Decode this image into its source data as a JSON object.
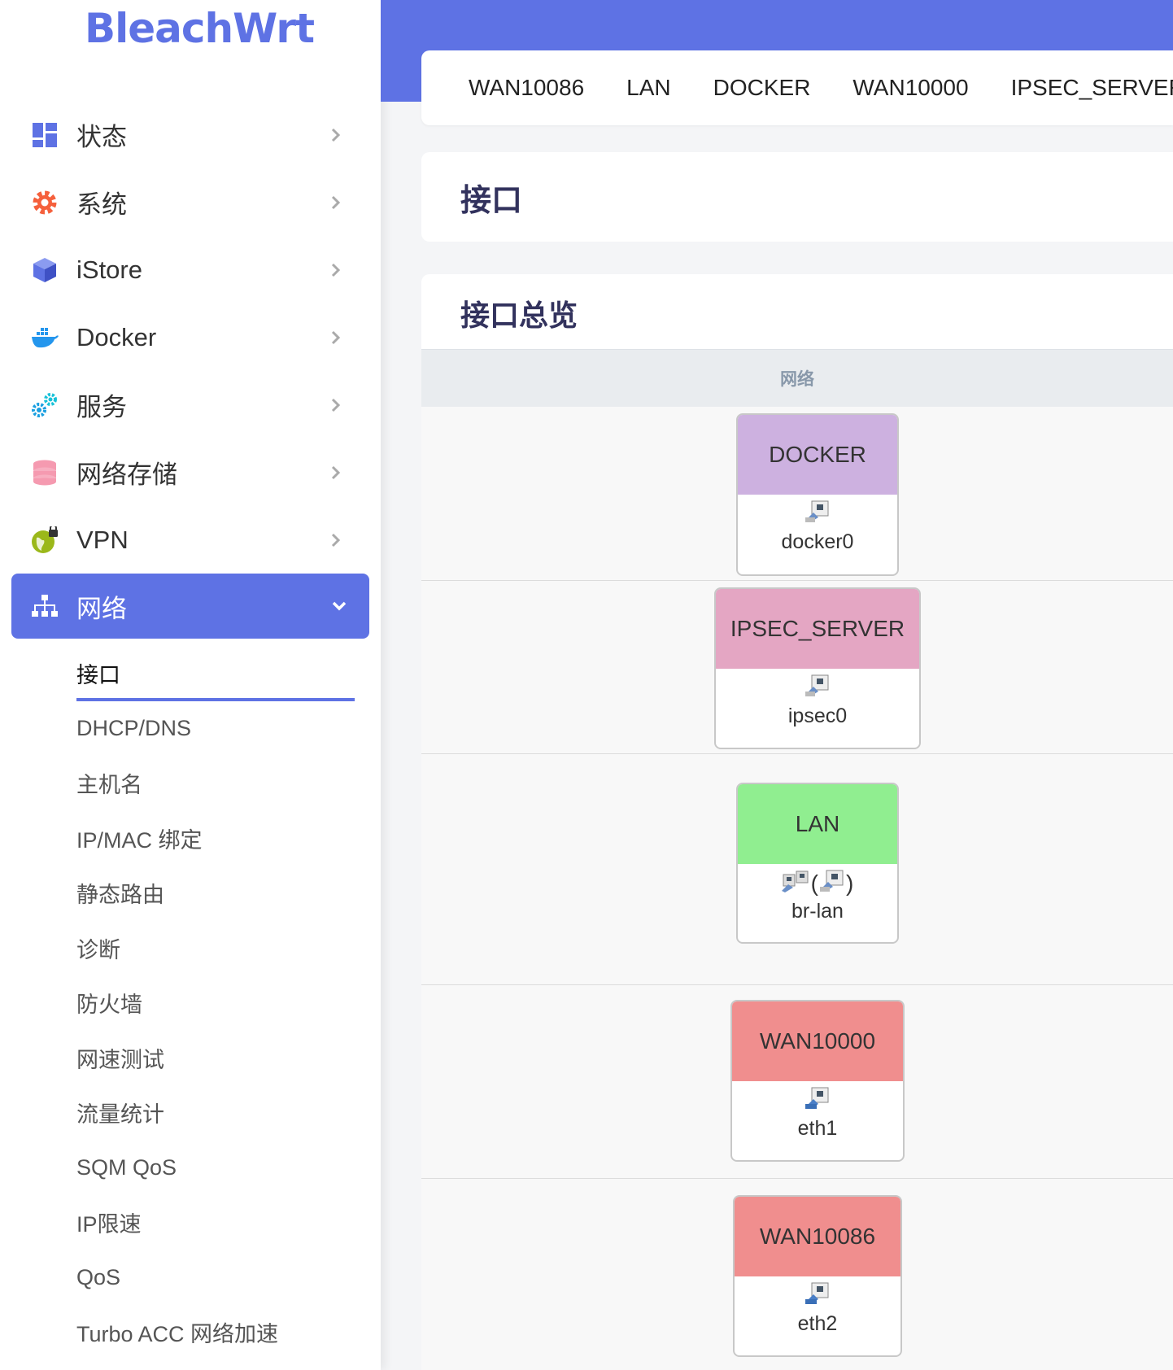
{
  "brand": "BleachWrt",
  "colors": {
    "accent": "#5e72e4",
    "docker": "#cdb1e0",
    "ipsec": "#e4a6c3",
    "lan": "#90ee90",
    "wan": "#f08e8e"
  },
  "sidebar": {
    "items": [
      {
        "label": "状态",
        "icon": "dashboard-icon"
      },
      {
        "label": "系统",
        "icon": "gear-icon"
      },
      {
        "label": "iStore",
        "icon": "cube-icon"
      },
      {
        "label": "Docker",
        "icon": "docker-whale-icon"
      },
      {
        "label": "服务",
        "icon": "gears-icon"
      },
      {
        "label": "网络存储",
        "icon": "database-icon"
      },
      {
        "label": "VPN",
        "icon": "globe-lock-icon"
      },
      {
        "label": "网络",
        "icon": "sitemap-icon"
      }
    ],
    "network_sub": [
      "接口",
      "DHCP/DNS",
      "主机名",
      "IP/MAC 绑定",
      "静态路由",
      "诊断",
      "防火墙",
      "网速测试",
      "流量统计",
      "SQM QoS",
      "IP限速",
      "QoS",
      "Turbo ACC 网络加速"
    ]
  },
  "tabs": [
    "WAN10086",
    "LAN",
    "DOCKER",
    "WAN10000",
    "IPSEC_SERVER"
  ],
  "page_title": "接口",
  "overview": {
    "title": "接口总览",
    "column_header": "网络",
    "interfaces": [
      {
        "name": "DOCKER",
        "device": "docker0"
      },
      {
        "name": "IPSEC_SERVER",
        "device": "ipsec0"
      },
      {
        "name": "LAN",
        "device": "br-lan",
        "icon_paren_open": "(",
        "icon_paren_close": ")"
      },
      {
        "name": "WAN10000",
        "device": "eth1"
      },
      {
        "name": "WAN10086",
        "device": "eth2"
      }
    ]
  }
}
